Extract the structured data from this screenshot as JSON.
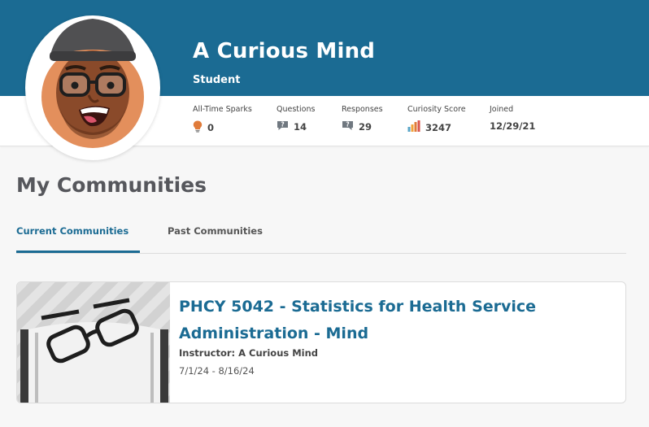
{
  "profile": {
    "name": "A Curious Mind",
    "role": "Student"
  },
  "stats": [
    {
      "label": "All-Time Sparks",
      "value": "0",
      "icon": "lightbulb-icon"
    },
    {
      "label": "Questions",
      "value": "14",
      "icon": "question-bubble-icon"
    },
    {
      "label": "Responses",
      "value": "29",
      "icon": "response-bubble-icon"
    },
    {
      "label": "Curiosity Score",
      "value": "3247",
      "icon": "bar-chart-icon"
    },
    {
      "label": "Joined",
      "value": "12/29/21",
      "icon": ""
    }
  ],
  "communities": {
    "title": "My Communities",
    "tabs": [
      {
        "label": "Current Communities",
        "active": true
      },
      {
        "label": "Past Communities",
        "active": false
      }
    ],
    "cards": [
      {
        "title": "PHCY 5042 - Statistics for Health Service Administration - Mind",
        "instructor": "Instructor: A Curious Mind",
        "dates": "7/1/24 - 8/16/24"
      }
    ]
  },
  "colors": {
    "brand": "#1b6b93",
    "spark": "#e07b3a",
    "question": "#707880"
  }
}
